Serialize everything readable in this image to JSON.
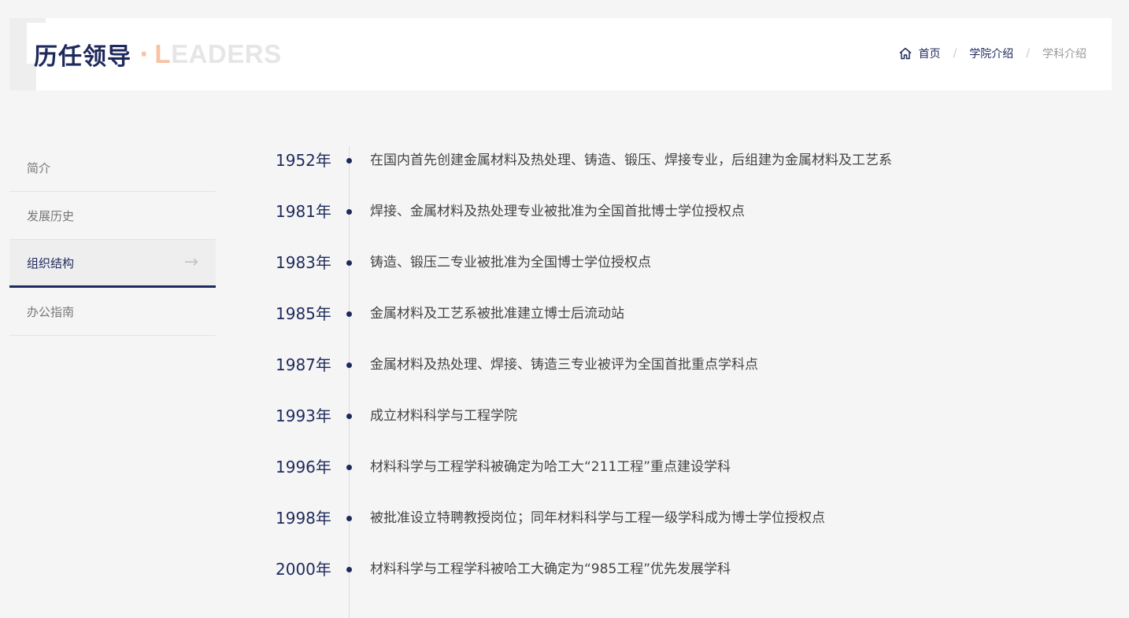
{
  "header": {
    "title_cn": "历任领导",
    "title_separator": "·",
    "title_en_first": "L",
    "title_en_rest": "EADERS"
  },
  "breadcrumb": {
    "icon": "home-icon",
    "items": [
      {
        "label": "首页"
      },
      {
        "label": "学院介绍"
      },
      {
        "label": "学科介绍"
      }
    ],
    "separator": "/"
  },
  "sidebar": {
    "items": [
      {
        "label": "简介",
        "active": false
      },
      {
        "label": "发展历史",
        "active": false
      },
      {
        "label": "组织结构",
        "active": true,
        "arrow": "→"
      },
      {
        "label": "办公指南",
        "active": false
      }
    ]
  },
  "timeline": {
    "events": [
      {
        "year": "1952年",
        "text": "在国内首先创建金属材料及热处理、铸造、锻压、焊接专业，后组建为金属材料及工艺系"
      },
      {
        "year": "1981年",
        "text": "焊接、金属材料及热处理专业被批准为全国首批博士学位授权点"
      },
      {
        "year": "1983年",
        "text": "铸造、锻压二专业被批准为全国博士学位授权点"
      },
      {
        "year": "1985年",
        "text": "金属材料及工艺系被批准建立博士后流动站"
      },
      {
        "year": "1987年",
        "text": "金属材料及热处理、焊接、铸造三专业被评为全国首批重点学科点"
      },
      {
        "year": "1993年",
        "text": "成立材料科学与工程学院"
      },
      {
        "year": "1996年",
        "text": "材料科学与工程学科被确定为哈工大“211工程”重点建设学科"
      },
      {
        "year": "1998年",
        "text": "被批准设立特聘教授岗位；同年材料科学与工程一级学科成为博士学位授权点"
      },
      {
        "year": "2000年",
        "text": "材料科学与工程学科被哈工大确定为“985工程”优先发展学科"
      }
    ]
  },
  "colors": {
    "primary": "#1f2a5c",
    "accent": "#f7c3a4",
    "background": "#f5f5f5"
  }
}
